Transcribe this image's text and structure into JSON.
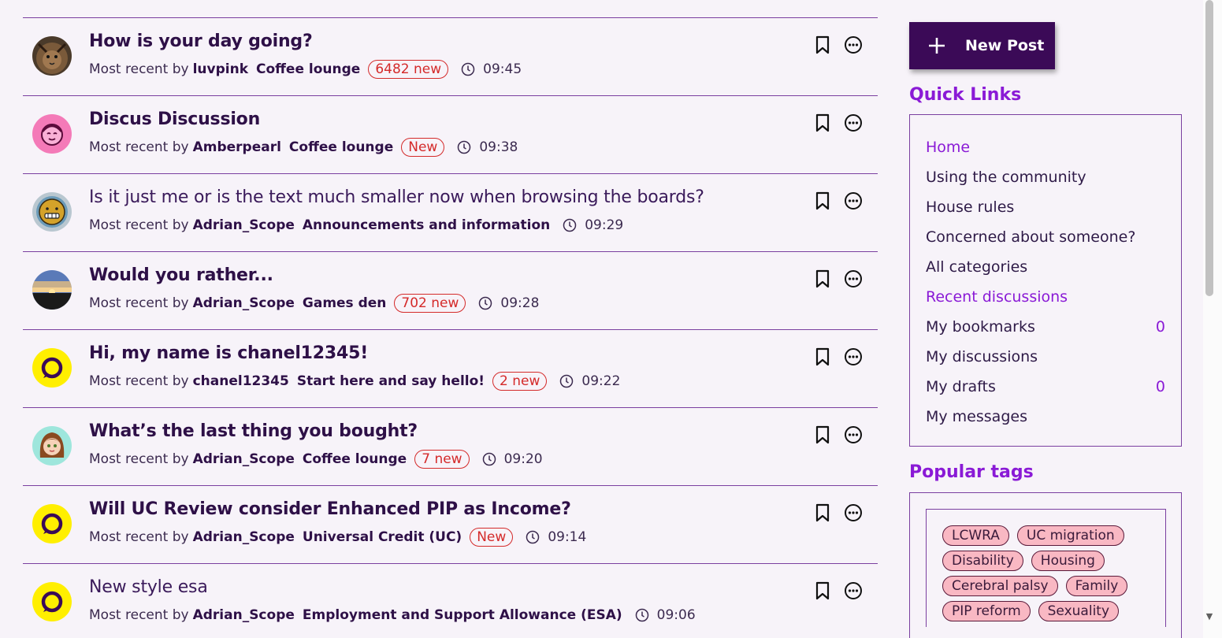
{
  "discussions": [
    {
      "title": "How is your day going?",
      "by": "Most recent by",
      "author": "luvpink",
      "category": "Coffee lounge",
      "badge": "6482 new",
      "time": "09:45",
      "style": "unread",
      "avatar": "lion-avatar"
    },
    {
      "title": "Discus Discussion",
      "by": "Most recent by",
      "author": "Amberpearl",
      "category": "Coffee lounge",
      "badge": "New",
      "time": "09:38",
      "style": "unread",
      "avatar": "pink-face-avatar"
    },
    {
      "title": "Is it just me or is the text much smaller now when browsing the boards?",
      "by": "Most recent by",
      "author": "Adrian_Scope",
      "category": "Announcements and information",
      "badge": "",
      "time": "09:29",
      "style": "read",
      "avatar": "grimace-avatar"
    },
    {
      "title": "Would you rather...",
      "by": "Most recent by",
      "author": "Adrian_Scope",
      "category": "Games den",
      "badge": "702 new",
      "time": "09:28",
      "style": "unread",
      "avatar": "sunset-avatar"
    },
    {
      "title": "Hi, my name is chanel12345!",
      "by": "Most recent by",
      "author": "chanel12345",
      "category": "Start here and say hello!",
      "badge": "2 new",
      "time": "09:22",
      "style": "unread",
      "avatar": "speech-bubble-avatar"
    },
    {
      "title": "What’s the last thing you bought?",
      "by": "Most recent by",
      "author": "Adrian_Scope",
      "category": "Coffee lounge",
      "badge": "7 new",
      "time": "09:20",
      "style": "unread",
      "avatar": "girl-avatar"
    },
    {
      "title": "Will UC Review consider Enhanced PIP as Income?",
      "by": "Most recent by",
      "author": "Adrian_Scope",
      "category": "Universal Credit (UC)",
      "badge": "New",
      "time": "09:14",
      "style": "unread",
      "avatar": "speech-bubble-avatar"
    },
    {
      "title": "New style esa",
      "by": "Most recent by",
      "author": "Adrian_Scope",
      "category": "Employment and Support Allowance (ESA)",
      "badge": "",
      "time": "09:06",
      "style": "read",
      "avatar": "speech-bubble-avatar"
    }
  ],
  "sidebar": {
    "new_post_label": "New Post",
    "quick_links_title": "Quick Links",
    "quick_links": [
      {
        "label": "Home",
        "count": "",
        "active": true
      },
      {
        "label": "Using the community",
        "count": "",
        "active": false
      },
      {
        "label": "House rules",
        "count": "",
        "active": false
      },
      {
        "label": "Concerned about someone?",
        "count": "",
        "active": false
      },
      {
        "label": "All categories",
        "count": "",
        "active": false
      },
      {
        "label": "Recent discussions",
        "count": "",
        "active": true
      },
      {
        "label": "My bookmarks",
        "count": "0",
        "active": false
      },
      {
        "label": "My discussions",
        "count": "",
        "active": false
      },
      {
        "label": "My drafts",
        "count": "0",
        "active": false
      },
      {
        "label": "My messages",
        "count": "",
        "active": false
      }
    ],
    "popular_tags_title": "Popular tags",
    "tags": [
      "LCWRA",
      "UC migration",
      "Disability",
      "Housing",
      "Cerebral palsy",
      "Family",
      "PIP reform",
      "Sexuality"
    ]
  },
  "colors": {
    "accent": "#8a1ad6",
    "primary_dark": "#3b0a57",
    "badge_red": "#d42a2a",
    "tag_pink": "#f9b8c3"
  }
}
